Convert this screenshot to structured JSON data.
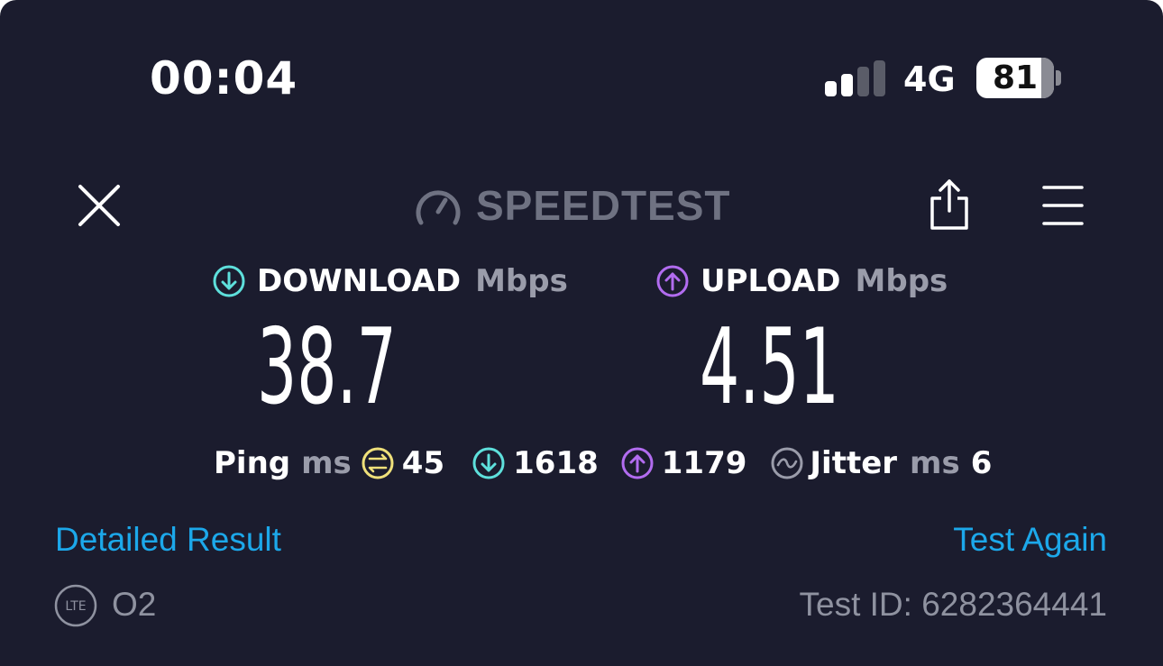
{
  "status_bar": {
    "time": "00:04",
    "network": "4G",
    "battery_level": "81",
    "signal_bars_active": 2,
    "signal_bars_total": 4
  },
  "header": {
    "logo_text": "SPEEDTEST",
    "icons": [
      "close-icon",
      "speedometer-icon",
      "share-icon",
      "menu-icon"
    ]
  },
  "download": {
    "label": "DOWNLOAD",
    "unit": "Mbps",
    "value": "38.7",
    "accent_color": "#5ee0dc"
  },
  "upload": {
    "label": "UPLOAD",
    "unit": "Mbps",
    "value": "4.51",
    "accent_color": "#b26cf0"
  },
  "latency": {
    "ping_label": "Ping",
    "ping_unit": "ms",
    "idle_ping": "45",
    "download_ping": "1618",
    "upload_ping": "1179",
    "jitter_label": "Jitter",
    "jitter_unit": "ms",
    "jitter": "6",
    "idle_color": "#efe07a"
  },
  "actions": {
    "detailed_result": "Detailed Result",
    "test_again": "Test Again"
  },
  "footer": {
    "connection_badge": "LTE",
    "carrier": "O2",
    "test_id": "Test ID: 6282364441"
  },
  "colors": {
    "background": "#1b1c2e",
    "link": "#1ca8ea",
    "muted": "#9a9caa"
  }
}
